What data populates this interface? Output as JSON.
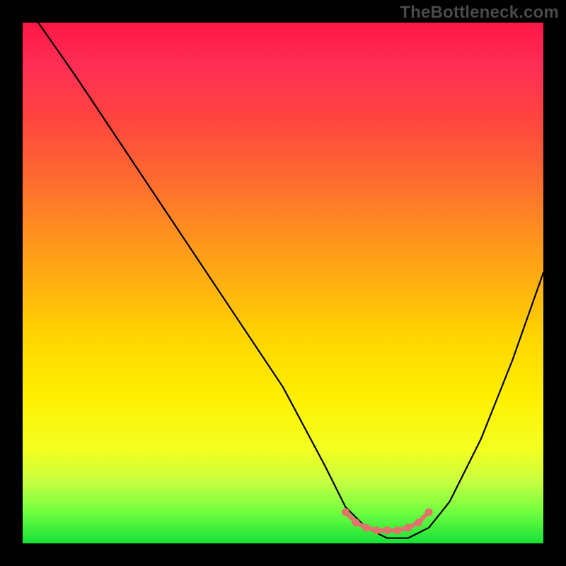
{
  "watermark": "TheBottleneck.com",
  "chart_data": {
    "type": "line",
    "title": "",
    "xlabel": "",
    "ylabel": "",
    "xlim": [
      0,
      100
    ],
    "ylim": [
      0,
      100
    ],
    "grid": false,
    "legend": false,
    "series": [
      {
        "name": "curve",
        "x": [
          3,
          10,
          20,
          30,
          40,
          50,
          58,
          62,
          66,
          70,
          74,
          78,
          82,
          88,
          94,
          100
        ],
        "values": [
          100,
          90,
          75,
          60,
          45,
          30,
          15,
          7,
          3,
          1,
          1,
          3,
          8,
          20,
          35,
          52
        ]
      }
    ],
    "markers": {
      "name": "optimal-flat-band",
      "color": "#e2736b",
      "x": [
        62,
        64,
        66,
        68,
        70,
        72,
        74,
        76,
        78
      ],
      "values": [
        6,
        4,
        3,
        2.5,
        2.5,
        2.5,
        3,
        4,
        6
      ]
    },
    "gradient_stops": [
      {
        "pos": 0,
        "color": "#ff1744"
      },
      {
        "pos": 50,
        "color": "#ffb010"
      },
      {
        "pos": 75,
        "color": "#fff000"
      },
      {
        "pos": 100,
        "color": "#18e038"
      }
    ]
  }
}
